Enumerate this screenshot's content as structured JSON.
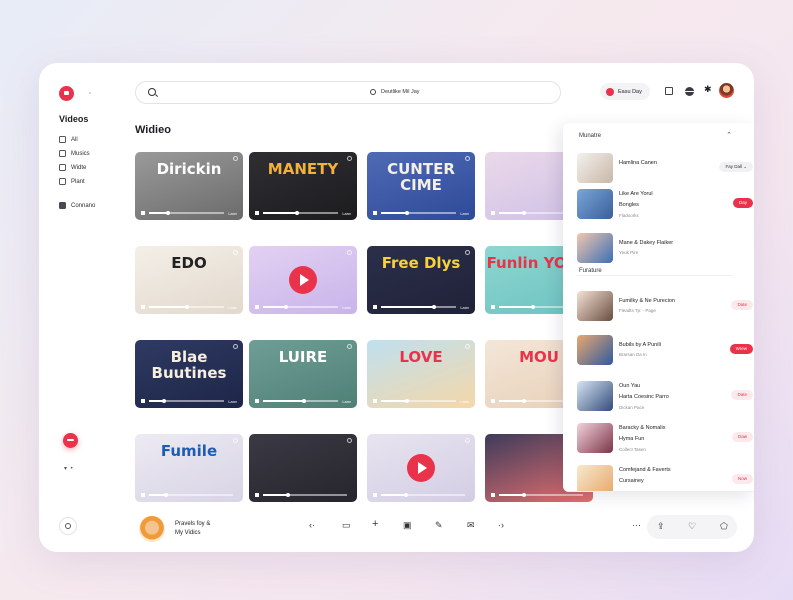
{
  "sidebar": {
    "title": "Videos",
    "items": [
      {
        "label": "All"
      },
      {
        "label": "Musics"
      },
      {
        "label": "Widte"
      },
      {
        "label": "Plant"
      },
      {
        "label": "Connano"
      }
    ]
  },
  "topbar": {
    "search_center_text": "Deutlike Mil Jay",
    "pill_label": "Easu Day"
  },
  "main": {
    "section_title": "Widieo",
    "tiles": [
      {
        "text": "Dirickin",
        "bar_label": "Lanv",
        "progress": 0.25
      },
      {
        "text": "MANETY",
        "bar_label": "Lanv",
        "progress": 0.45
      },
      {
        "text": "CUNTER CIME",
        "bar_label": "Lanv",
        "progress": 0.35
      },
      {
        "text": "",
        "bar_label": "",
        "progress": 0.3
      },
      {
        "text": "EDO",
        "bar_label": "Lanv",
        "progress": 0.5
      },
      {
        "text": "",
        "bar_label": "Lanv",
        "progress": 0.3
      },
      {
        "text": "Free Dlys",
        "bar_label": "Lanv",
        "progress": 0.7
      },
      {
        "text": "Funlin YOUN",
        "bar_label": "",
        "progress": 0.4
      },
      {
        "text": "Blae Buutines",
        "bar_label": "Lanv",
        "progress": 0.2
      },
      {
        "text": "LUIRE",
        "bar_label": "Lanv",
        "progress": 0.55
      },
      {
        "text": "LOVE",
        "bar_label": "Lanv",
        "progress": 0.35
      },
      {
        "text": "MOU",
        "bar_label": "",
        "progress": 0.3
      },
      {
        "text": "Fumile",
        "bar_label": "",
        "progress": 0.2
      },
      {
        "text": "",
        "bar_label": "",
        "progress": 0.3
      },
      {
        "text": "",
        "bar_label": "",
        "progress": 0.3
      },
      {
        "text": "",
        "bar_label": "",
        "progress": 0.3
      }
    ]
  },
  "panel": {
    "header": "Munatre",
    "subheader": "Furature",
    "items": [
      {
        "title": "Hamlina Canen",
        "meta": "",
        "badge": "Fay Dall"
      },
      {
        "title": "Like Are Yorul\nBongles",
        "meta": "Fladoorks",
        "badge": "Day"
      },
      {
        "title": "Mane & Dakey Flaiker",
        "meta": "Yeuk Pire",
        "badge": ""
      },
      {
        "title": "Fumilky & Ne Purecion",
        "meta": "Fleadts Tp: - Page",
        "badge": "Date"
      },
      {
        "title": "Bubils by A Punili",
        "meta": "Brarsan Da In",
        "badge": "Wrew"
      },
      {
        "title": "Oun Yau\nHarta Coesinc Parro",
        "meta": "Dickan Pace",
        "badge": "Date"
      },
      {
        "title": "Baracky & Nomalix\nHyma Fun",
        "meta": "Collect Tasen",
        "badge": "Daw"
      },
      {
        "title": "Comfejand & Faverts\nCursainey",
        "meta": "",
        "badge": "Now"
      }
    ]
  },
  "nowplaying": {
    "line1": "Pravels foy &",
    "line2": "My Vidics"
  },
  "colors": {
    "accent": "#e8334a",
    "background": "#ffffff"
  }
}
